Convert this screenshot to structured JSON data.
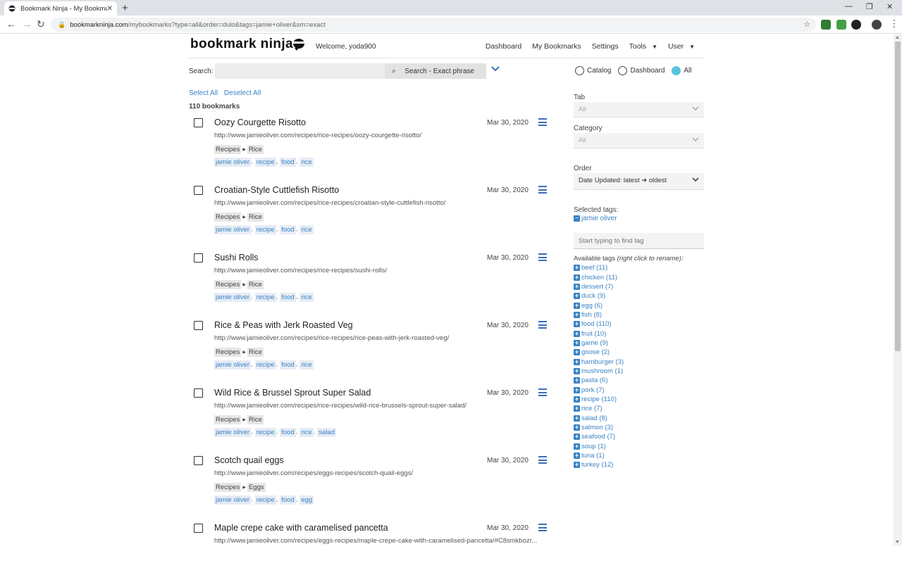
{
  "browser": {
    "tab_title": "Bookmark Ninja - My Bookmarks",
    "url_host": "bookmarkninja.com",
    "url_path": "/mybookmarks?type=all&order=dulo&tags=jamie+oliver&sm=exact"
  },
  "header": {
    "logo": "bookmark ninja",
    "welcome_prefix": "Welcome,",
    "username": "yoda900",
    "nav": [
      "Dashboard",
      "My Bookmarks",
      "Settings",
      "Tools",
      "User"
    ]
  },
  "search": {
    "label": "Search:",
    "value": "",
    "button_label": "Search - Exact phrase"
  },
  "selection": {
    "select_all": "Select All",
    "deselect_all": "Deselect All",
    "count": "110 bookmarks"
  },
  "bookmarks": [
    {
      "title": "Oozy Courgette Risotto",
      "date": "Mar 30, 2020",
      "url": "http://www.jamieoliver.com/recipes/rice-recipes/oozy-courgette-risotto/",
      "tab": "Recipes",
      "category": "Rice",
      "tags": [
        "jamie oliver",
        "recipe",
        "food",
        "rice"
      ]
    },
    {
      "title": "Croatian-Style Cuttlefish Risotto",
      "date": "Mar 30, 2020",
      "url": "http://www.jamieoliver.com/recipes/rice-recipes/croatian-style-cuttlefish-risotto/",
      "tab": "Recipes",
      "category": "Rice",
      "tags": [
        "jamie oliver",
        "recipe",
        "food",
        "rice"
      ]
    },
    {
      "title": "Sushi Rolls",
      "date": "Mar 30, 2020",
      "url": "http://www.jamieoliver.com/recipes/rice-recipes/sushi-rolls/",
      "tab": "Recipes",
      "category": "Rice",
      "tags": [
        "jamie oliver",
        "recipe",
        "food",
        "rice"
      ]
    },
    {
      "title": "Rice & Peas with Jerk Roasted Veg",
      "date": "Mar 30, 2020",
      "url": "http://www.jamieoliver.com/recipes/rice-recipes/rice-peas-with-jerk-roasted-veg/",
      "tab": "Recipes",
      "category": "Rice",
      "tags": [
        "jamie oliver",
        "recipe",
        "food",
        "rice"
      ]
    },
    {
      "title": "Wild Rice & Brussel Sprout Super Salad",
      "date": "Mar 30, 2020",
      "url": "http://www.jamieoliver.com/recipes/rice-recipes/wild-rice-brussels-sprout-super-salad/",
      "tab": "Recipes",
      "category": "Rice",
      "tags": [
        "jamie oliver",
        "recipe",
        "food",
        "rice",
        "salad"
      ]
    },
    {
      "title": "Scotch quail eggs",
      "date": "Mar 30, 2020",
      "url": "http://www.jamieoliver.com/recipes/eggs-recipes/scotch-quail-eggs/",
      "tab": "Recipes",
      "category": "Eggs",
      "tags": [
        "jamie oliver",
        "recipe",
        "food",
        "egg"
      ]
    },
    {
      "title": "Maple crepe cake with caramelised pancetta",
      "date": "Mar 30, 2020",
      "url": "http://www.jamieoliver.com/recipes/eggs-recipes/maple-crepe-cake-with-caramelised-pancetta/#C8smkbozr...",
      "tab": "",
      "category": "",
      "tags": []
    }
  ],
  "filters": {
    "radios": [
      {
        "label": "Catalog",
        "checked": false
      },
      {
        "label": "Dashboard",
        "checked": false
      },
      {
        "label": "All",
        "checked": true
      }
    ],
    "tab_label": "Tab",
    "tab_value": "All",
    "category_label": "Category",
    "category_value": "All",
    "order_label": "Order",
    "order_value": "Date Updated: latest ➔ oldest",
    "selected_tags_label": "Selected tags:",
    "selected_tags": [
      "jamie oliver"
    ],
    "tag_search_placeholder": "Start typing to find tag",
    "available_label": "Available tags",
    "available_hint": "(right click to rename):",
    "available_tags": [
      "beef (11)",
      "chicken (11)",
      "dessert (7)",
      "duck (9)",
      "egg (6)",
      "fish (8)",
      "food (110)",
      "fruit (10)",
      "game (9)",
      "goose (2)",
      "hamburger (3)",
      "mushroom (1)",
      "pasta (6)",
      "pork (7)",
      "recipe (110)",
      "rice (7)",
      "salad (8)",
      "salmon (3)",
      "seafood (7)",
      "soup (1)",
      "tuna (1)",
      "turkey (12)"
    ]
  },
  "colors": {
    "link": "#3b83c4",
    "accent_radio": "#5bc4dd"
  }
}
